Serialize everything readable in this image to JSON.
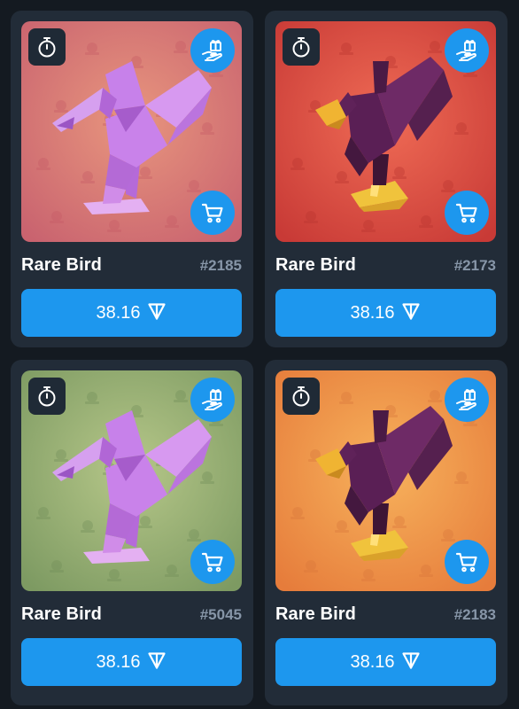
{
  "cards": [
    {
      "name": "Rare Bird",
      "number": "#2185",
      "price": "38.16",
      "background": "pink",
      "bird": "purple-pelican",
      "bg_colors": [
        "#e8967e",
        "#c9636f"
      ],
      "pattern_color": "#c55964"
    },
    {
      "name": "Rare Bird",
      "number": "#2173",
      "price": "38.16",
      "background": "red",
      "bird": "dark-purple-bird",
      "bg_colors": [
        "#ef6b55",
        "#c83a36"
      ],
      "pattern_color": "#b8332e"
    },
    {
      "name": "Rare Bird",
      "number": "#5045",
      "price": "38.16",
      "background": "green",
      "bird": "purple-pelican",
      "bg_colors": [
        "#b6c789",
        "#7d9a62"
      ],
      "pattern_color": "#6f8c57"
    },
    {
      "name": "Rare Bird",
      "number": "#2183",
      "price": "38.16",
      "background": "orange",
      "bird": "dark-purple-bird",
      "bg_colors": [
        "#f7b25c",
        "#e67c3b"
      ],
      "pattern_color": "#d8753a"
    }
  ],
  "icons": {
    "timer": "stopwatch-icon",
    "gift": "gift-hand-icon",
    "cart": "shopping-cart-icon",
    "currency": "ton-icon"
  },
  "colors": {
    "accent": "#1d97ee",
    "page_bg": "#141a21",
    "card_bg": "#222c38",
    "muted_text": "#8796a8"
  }
}
